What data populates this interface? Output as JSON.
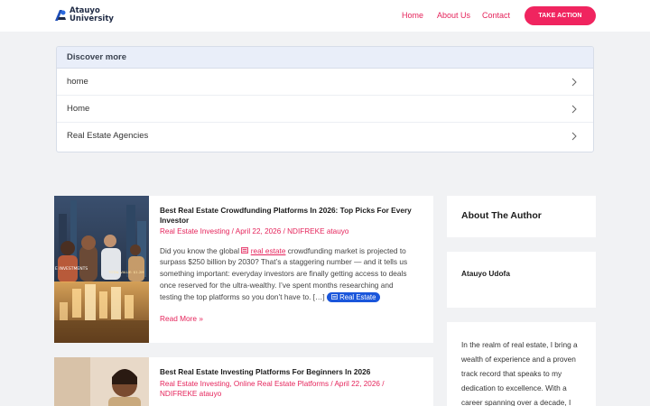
{
  "header": {
    "logo_line1": "Atauyo",
    "logo_line2": "University",
    "nav": [
      "Home",
      "About Us",
      "Contact"
    ],
    "cta_label": "TAKE ACTION"
  },
  "discover": {
    "title": "Discover more",
    "items": [
      "home",
      "Home",
      "Real Estate Agencies"
    ]
  },
  "articles": [
    {
      "title": "Best Real Estate Crowdfunding Platforms In 2026: Top Picks For Every Investor",
      "categories": "Real Estate Investing",
      "date": "April 22, 2026",
      "author": "NDIFREKE atauyo",
      "excerpt_pre": "Did you know the global ",
      "excerpt_keyword": "real estate",
      "excerpt_post": " crowdfunding market is projected to surpass $250 billion by 2030? That’s a staggering number — and it tells us something important: everyday investors are finally getting access to deals once reserved for the ultra-wealthy. I’ve spent months researching and testing the top platforms so you don’t have to. […]",
      "tag": "Real Estate",
      "read_more": "Read More »",
      "thumb_text_left": "E INVESTMENTS",
      "thumb_text_right": "TOTAL VALUE: $1.2M"
    },
    {
      "title": "Best Real Estate Investing Platforms For Beginners In 2026",
      "categories": "Real Estate Investing, Online Real Estate Platforms",
      "date": "April 22, 2026",
      "author": "NDIFREKE atauyo"
    }
  ],
  "sidebar": {
    "about_title": "About The Author",
    "author_name": "Atauyo Udofa",
    "bio": "In the realm of real estate, I bring a wealth of experience and a proven track record that speaks to my dedication to excellence. With a career spanning over a decade, I"
  },
  "colors": {
    "accent": "#e5245b",
    "cta": "#f0245f",
    "tag": "#1a56db",
    "background": "#f1f2f4"
  }
}
